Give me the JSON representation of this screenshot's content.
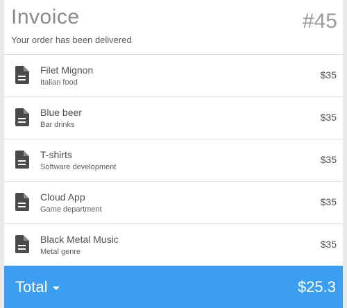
{
  "header": {
    "title": "Invoice",
    "subtitle": "Your order has been delivered",
    "number": "#45"
  },
  "items": [
    {
      "name": "Filet Mignon",
      "category": "Italian food",
      "price": "$35",
      "icon": "document-icon"
    },
    {
      "name": "Blue beer",
      "category": "Bar drinks",
      "price": "$35",
      "icon": "document-icon"
    },
    {
      "name": "T-shirts",
      "category": "Software development",
      "price": "$35",
      "icon": "document-icon"
    },
    {
      "name": "Cloud App",
      "category": "Game department",
      "price": "$35",
      "icon": "document-icon"
    },
    {
      "name": "Black Metal Music",
      "category": "Metal genre",
      "price": "$35",
      "icon": "document-icon"
    }
  ],
  "footer": {
    "total_label": "Total",
    "total_amount": "$25.3",
    "dropdown_icon": "caret-down-icon"
  },
  "colors": {
    "accent": "#3c9ef0",
    "icon": "#4a4a4a"
  }
}
